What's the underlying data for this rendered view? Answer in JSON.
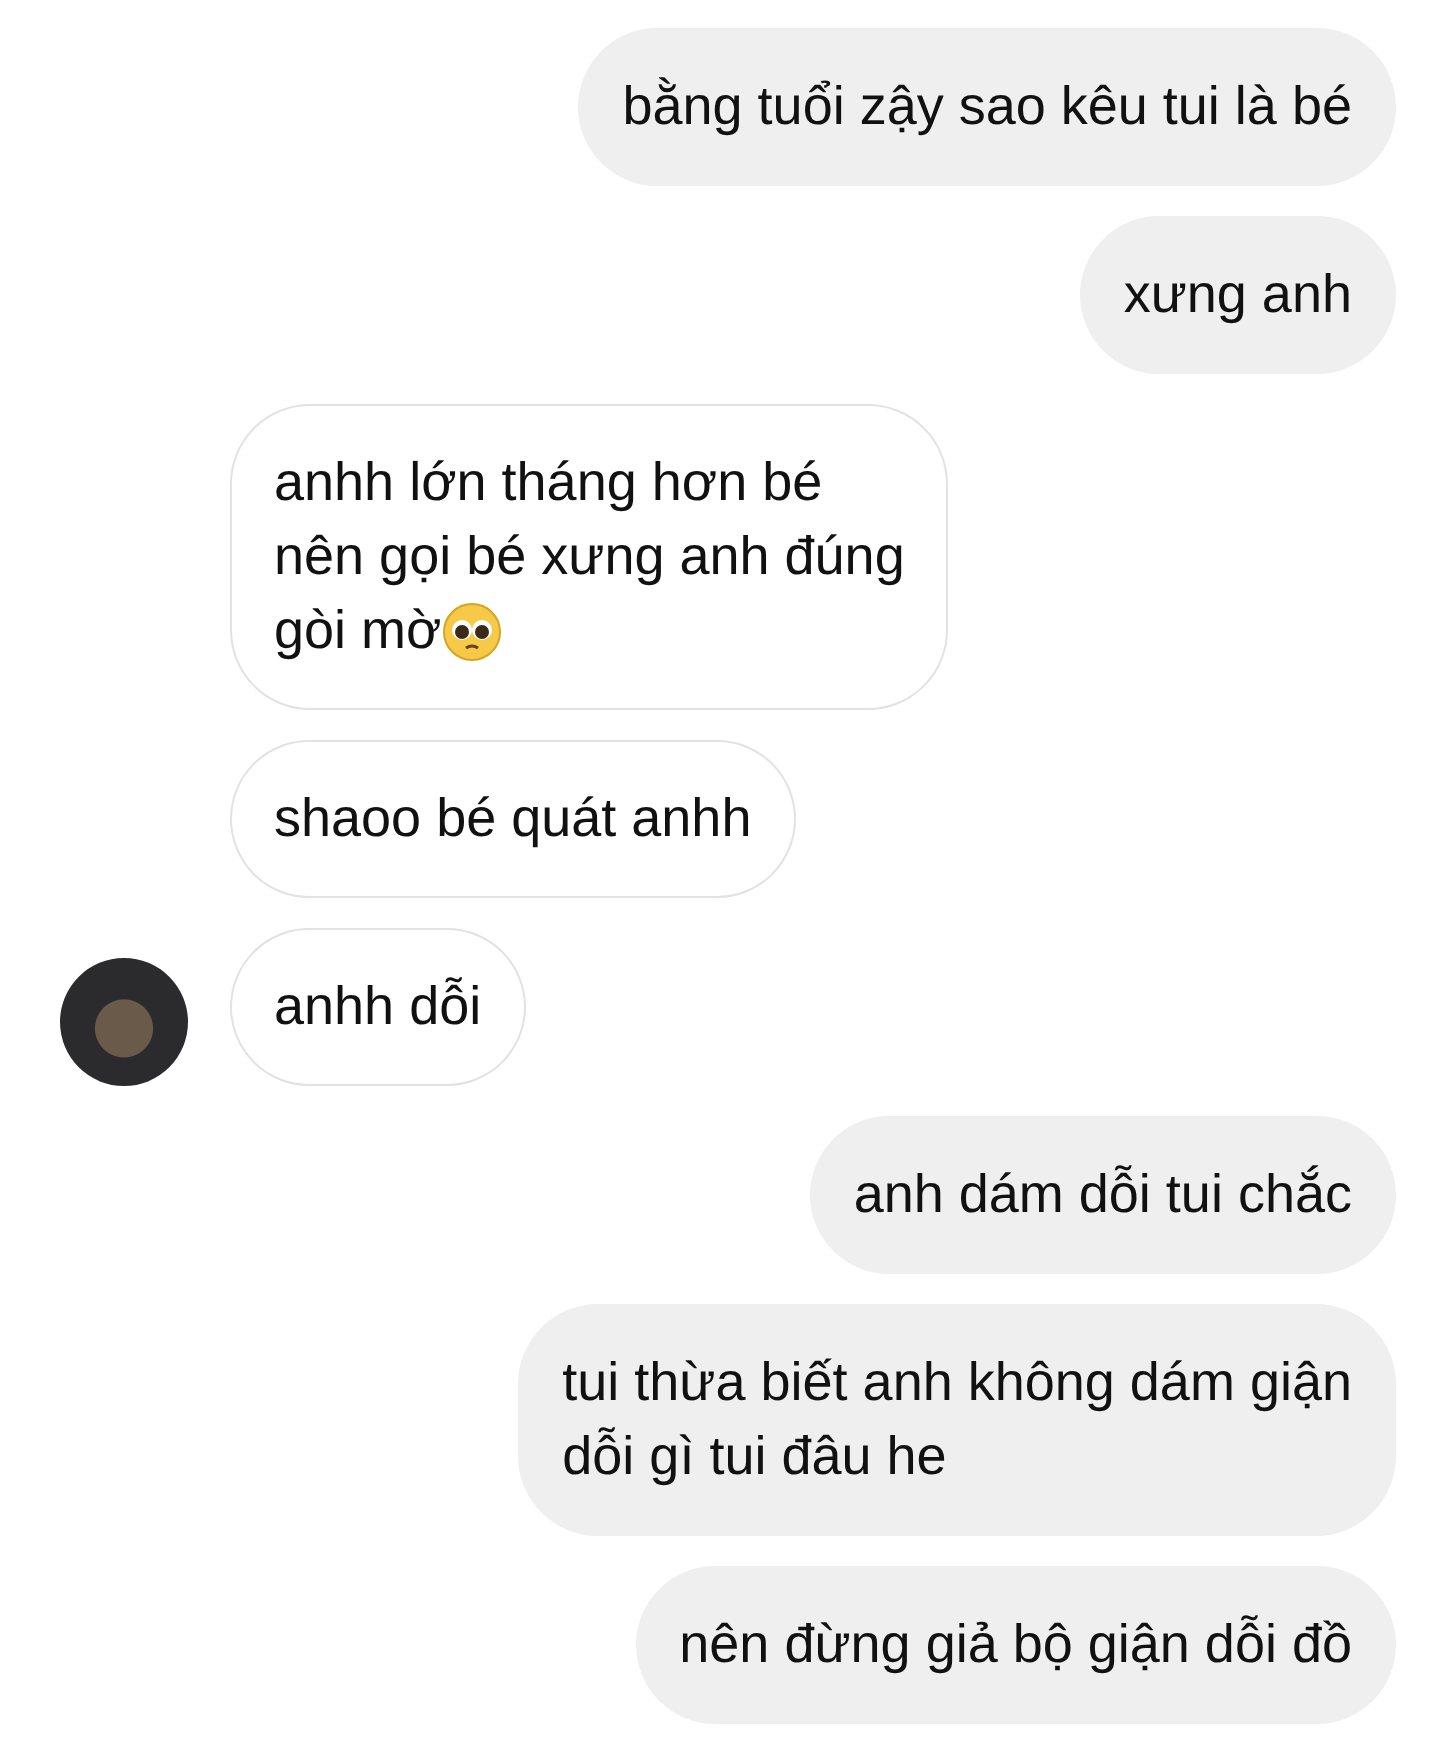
{
  "messages": [
    {
      "kind": "sent",
      "lines": [
        "bằng tuổi zậy sao kêu tui là bé"
      ]
    },
    {
      "kind": "sent",
      "lines": [
        "xưng anh"
      ]
    },
    {
      "kind": "received",
      "lines": [
        "anhh lớn tháng hơn bé",
        "nên gọi bé xưng anh đúng",
        "gòi mờ"
      ],
      "trailing_emoji": true
    },
    {
      "kind": "received",
      "lines": [
        "shaoo bé quát anhh"
      ]
    },
    {
      "kind": "received",
      "lines": [
        "anhh dỗi"
      ],
      "avatar": true
    },
    {
      "kind": "sent",
      "lines": [
        "anh dám dỗi tui chắc"
      ]
    },
    {
      "kind": "sent",
      "lines": [
        "tui thừa biết anh không dám giận",
        "dỗi gì tui đâu he"
      ]
    },
    {
      "kind": "sent",
      "lines": [
        "nên đừng giả bộ giận dỗi đồ"
      ]
    }
  ]
}
